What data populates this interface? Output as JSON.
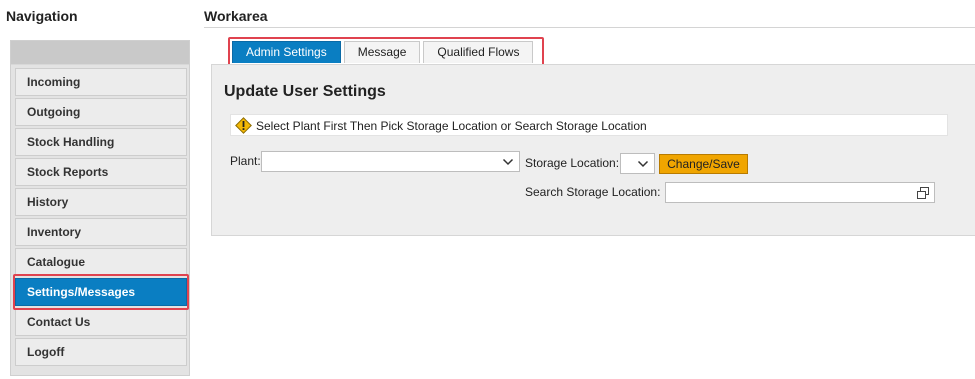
{
  "navigation": {
    "heading": "Navigation",
    "items": [
      {
        "label": "Incoming"
      },
      {
        "label": "Outgoing"
      },
      {
        "label": "Stock Handling"
      },
      {
        "label": "Stock Reports"
      },
      {
        "label": "History"
      },
      {
        "label": "Inventory"
      },
      {
        "label": "Catalogue"
      },
      {
        "label": "Settings/Messages",
        "active": true
      },
      {
        "label": "Contact Us"
      },
      {
        "label": "Logoff"
      }
    ]
  },
  "workarea": {
    "heading": "Workarea",
    "tabs": [
      {
        "label": "Admin Settings",
        "active": true
      },
      {
        "label": "Message"
      },
      {
        "label": "Qualified Flows"
      }
    ],
    "panel_title": "Update User Settings",
    "warning": {
      "icon": "warning-icon",
      "text": "Select Plant First Then Pick Storage Location or Search Storage Location"
    },
    "form": {
      "plant_label": "Plant:",
      "plant_value": "",
      "storage_location_label": "Storage Location:",
      "storage_location_value": "",
      "save_button": "Change/Save",
      "search_label": "Search Storage Location:",
      "search_value": "",
      "search_icon": "value-help-icon"
    }
  },
  "colors": {
    "accent": "#0a7ec2",
    "button": "#f0a500",
    "highlight": "#e0434f"
  }
}
